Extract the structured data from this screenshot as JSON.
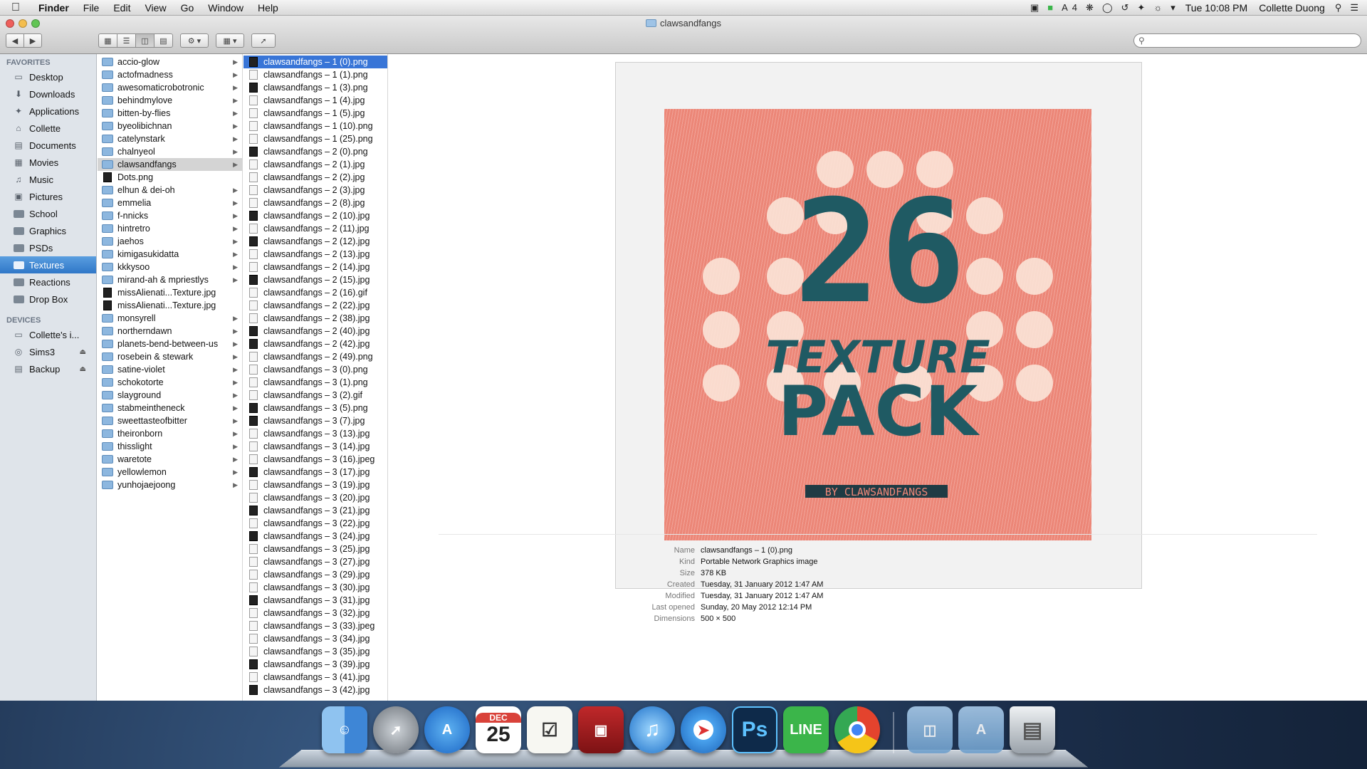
{
  "menubar": {
    "app_name": "Finder",
    "menus": [
      "File",
      "Edit",
      "View",
      "Go",
      "Window",
      "Help"
    ],
    "status_badge_count": "4",
    "clock": "Tue 10:08 PM",
    "user": "Collette Duong"
  },
  "window": {
    "title": "clawsandfangs",
    "search_placeholder": ""
  },
  "sidebar": {
    "favorites_header": "FAVORITES",
    "favorites": [
      "Desktop",
      "Downloads",
      "Applications",
      "Collette",
      "Documents",
      "Movies",
      "Music",
      "Pictures",
      "School",
      "Graphics",
      "PSDs",
      "Textures",
      "Reactions",
      "Drop Box"
    ],
    "selected_favorite": "Textures",
    "devices_header": "DEVICES",
    "devices": [
      "Collette's i...",
      "Sims3",
      "Backup"
    ]
  },
  "column1": [
    "accio-glow",
    "actofmadness",
    "awesomaticrobotronic",
    "behindmylove",
    "bitten-by-flies",
    "byeolibichnan",
    "catelynstark",
    "chalnyeol",
    "clawsandfangs",
    "Dots.png",
    "elhun & dei-oh",
    "emmelia",
    "f-nnicks",
    "hintretro",
    "jaehos",
    "kimigasukidatta",
    "kkkysoo",
    "mirand-ah & mpriestlys",
    "missAlienati...Texture.jpg",
    "missAlienati...Texture.jpg",
    "monsyrell",
    "northerndawn",
    "planets-bend-between-us",
    "rosebein & stewark",
    "satine-violet",
    "schokotorte",
    "slayground",
    "stabmeintheneck",
    "sweettasteofbitter",
    "theironborn",
    "thisslight",
    "waretote",
    "yellowlemon",
    "yunhojaejoong"
  ],
  "column2": [
    "clawsandfangs – 1 (0).png",
    "clawsandfangs – 1 (1).png",
    "clawsandfangs – 1 (3).png",
    "clawsandfangs – 1 (4).jpg",
    "clawsandfangs – 1 (5).jpg",
    "clawsandfangs – 1 (10).png",
    "clawsandfangs – 1 (25).png",
    "clawsandfangs – 2 (0).png",
    "clawsandfangs – 2 (1).jpg",
    "clawsandfangs – 2 (2).jpg",
    "clawsandfangs – 2 (3).jpg",
    "clawsandfangs – 2 (8).jpg",
    "clawsandfangs – 2 (10).jpg",
    "clawsandfangs – 2 (11).jpg",
    "clawsandfangs – 2 (12).jpg",
    "clawsandfangs – 2 (13).jpg",
    "clawsandfangs – 2 (14).jpg",
    "clawsandfangs – 2 (15).jpg",
    "clawsandfangs – 2 (16).gif",
    "clawsandfangs – 2 (22).jpg",
    "clawsandfangs – 2 (38).jpg",
    "clawsandfangs – 2 (40).jpg",
    "clawsandfangs – 2 (42).jpg",
    "clawsandfangs – 2 (49).png",
    "clawsandfangs – 3 (0).png",
    "clawsandfangs – 3 (1).png",
    "clawsandfangs – 3 (2).gif",
    "clawsandfangs – 3 (5).png",
    "clawsandfangs – 3 (7).jpg",
    "clawsandfangs – 3 (13).jpg",
    "clawsandfangs – 3 (14).jpg",
    "clawsandfangs – 3 (16).jpeg",
    "clawsandfangs – 3 (17).jpg",
    "clawsandfangs – 3 (19).jpg",
    "clawsandfangs – 3 (20).jpg",
    "clawsandfangs – 3 (21).jpg",
    "clawsandfangs – 3 (22).jpg",
    "clawsandfangs – 3 (24).jpg",
    "clawsandfangs – 3 (25).jpg",
    "clawsandfangs – 3 (27).jpg",
    "clawsandfangs – 3 (29).jpg",
    "clawsandfangs – 3 (30).jpg",
    "clawsandfangs – 3 (31).jpg",
    "clawsandfangs – 3 (32).jpg",
    "clawsandfangs – 3 (33).jpeg",
    "clawsandfangs – 3 (34).jpg",
    "clawsandfangs – 3 (35).jpg",
    "clawsandfangs – 3 (39).jpg",
    "clawsandfangs – 3 (41).jpg",
    "clawsandfangs – 3 (42).jpg"
  ],
  "preview": {
    "art_number": "26",
    "art_line1": "TEXTURE",
    "art_line2": "PACK",
    "art_credit": "BY CLAWSANDFANGS",
    "colors": {
      "art_bg": "#ec8677",
      "art_text": "#1f5a63",
      "art_dots": "#fbe3d6"
    }
  },
  "info": {
    "labels": [
      "Name",
      "Kind",
      "Size",
      "Created",
      "Modified",
      "Last opened",
      "Dimensions"
    ],
    "values": [
      "clawsandfangs – 1 (0).png",
      "Portable Network Graphics image",
      "378 KB",
      "Tuesday, 31 January 2012 1:47 AM",
      "Tuesday, 31 January 2012 1:47 AM",
      "Sunday, 20 May 2012 12:14 PM",
      "500 × 500"
    ]
  },
  "dock": {
    "calendar_month": "DEC",
    "calendar_day": "25",
    "photoshop_label": "Ps",
    "line_label": "LINE"
  }
}
